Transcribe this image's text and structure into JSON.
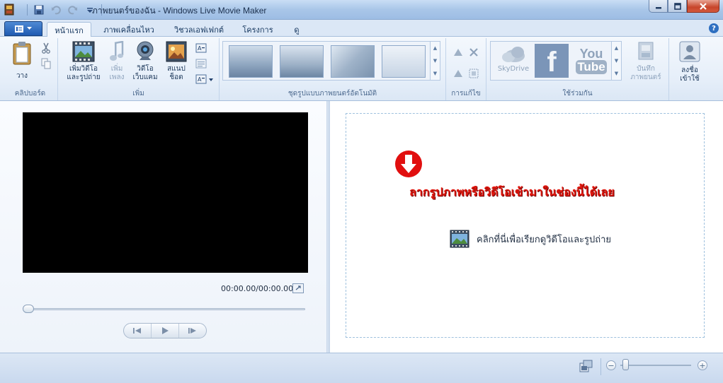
{
  "window": {
    "title": "ภาพยนตร์ของฉัน - Windows Live Movie Maker",
    "controls": {
      "minimize": "minimize",
      "maximize": "maximize",
      "close": "close"
    }
  },
  "quick_access": [
    "save-icon",
    "undo-icon",
    "redo-icon",
    "customize-icon"
  ],
  "tabs": [
    {
      "label": "หน้าแรก",
      "active": true
    },
    {
      "label": "ภาพเคลื่อนไหว",
      "active": false
    },
    {
      "label": "วิชวลเอฟเฟกต์",
      "active": false
    },
    {
      "label": "โครงการ",
      "active": false
    },
    {
      "label": "ดู",
      "active": false
    }
  ],
  "ribbon": {
    "clipboard": {
      "label": "คลิปบอร์ด",
      "paste": "วาง"
    },
    "add": {
      "label": "เพิ่ม",
      "add_videos_1": "เพิ่มวิดีโอ",
      "add_videos_2": "และรูปถ่าย",
      "add_music_1": "เพิ่ม",
      "add_music_2": "เพลง",
      "webcam_1": "วิดีโอ",
      "webcam_2": "เว็บแคม",
      "snapshot_1": "สแนป",
      "snapshot_2": "ช็อต"
    },
    "automovie": {
      "label": "ชุดรูปแบบภาพยนตร์อัตโนมัติ"
    },
    "editing": {
      "label": "การแก้ไข"
    },
    "sharing": {
      "label": "ใช้ร่วมกัน",
      "skydrive": "SkyDrive",
      "facebook": "f",
      "youtube_1": "You",
      "youtube_2": "Tube",
      "save_movie_1": "บันทึก",
      "save_movie_2": "ภาพยนตร์"
    },
    "signin": {
      "line1": "ลงชื่อ",
      "line2": "เข้าใช้"
    }
  },
  "preview": {
    "timecode": "00:00.00/00:00.00"
  },
  "storyboard": {
    "drop_hint": "ลากรูปภาพหรือวิดีโอเข้ามาในช่องนี้ได้เลย",
    "browse_text": "คลิกที่นี่เพื่อเรียกดูวิดีโอและรูปถ่าย"
  },
  "status": {
    "zoom_minus": "−",
    "zoom_plus": "+",
    "zoom_level": 0.03
  },
  "colors": {
    "accent": "#2e6fc1",
    "drop_hint": "#e0180f",
    "video_bg": "#000000"
  }
}
